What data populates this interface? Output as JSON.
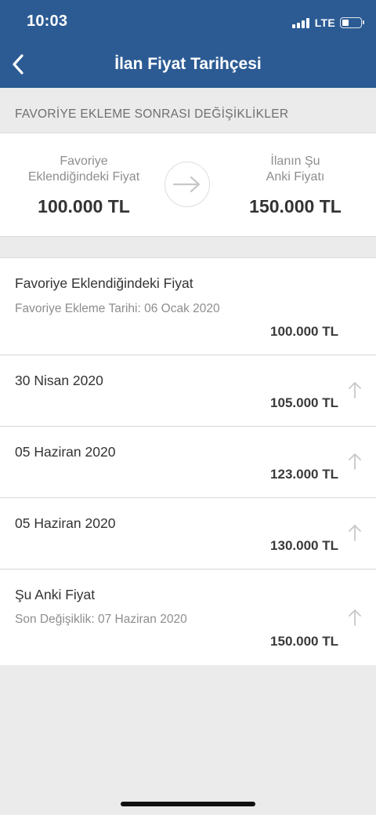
{
  "status_bar": {
    "time": "10:03",
    "network": "LTE"
  },
  "header": {
    "title": "İlan Fiyat Tarihçesi"
  },
  "section_title": "FAVORİYE EKLEME SONRASI DEĞİŞİKLİKLER",
  "summary": {
    "left_label_line1": "Favoriye",
    "left_label_line2": "Eklendiğindeki Fiyat",
    "left_value": "100.000 TL",
    "right_label_line1": "İlanın Şu",
    "right_label_line2": "Anki Fiyatı",
    "right_value": "150.000 TL"
  },
  "history": [
    {
      "title": "Favoriye Eklendiğindeki Fiyat",
      "subtitle": "Favoriye Ekleme Tarihi: 06 Ocak 2020",
      "price": "100.000 TL"
    },
    {
      "title": "30 Nisan 2020",
      "price": "105.000 TL"
    },
    {
      "title": "05 Haziran 2020",
      "price": "123.000 TL"
    },
    {
      "title": "05 Haziran 2020",
      "price": "130.000 TL"
    },
    {
      "title": "Şu Anki Fiyat",
      "subtitle": "Son Değişiklik: 07 Haziran 2020",
      "price": "150.000 TL"
    }
  ],
  "colors": {
    "header": "#2c5b94",
    "background": "#ebebeb",
    "arrow": "#c8c8c8"
  },
  "icons": {
    "back": "chevron-left-icon",
    "compare": "arrow-right-icon",
    "trend": "arrow-up-icon"
  }
}
